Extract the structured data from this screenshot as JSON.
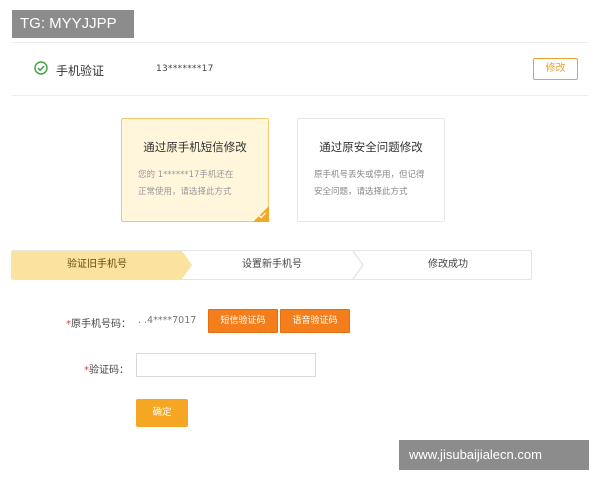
{
  "watermarks": {
    "tg": "TG: MYYJJPP",
    "url": "www.jisubaijialecn.com"
  },
  "verify_row": {
    "label": "手机验证",
    "phone": "13*******17",
    "edit_label": "修改",
    "icon": "check-circle-icon"
  },
  "options": [
    {
      "title": "通过原手机短信修改",
      "desc_line1": "您的 1******17手机还在",
      "desc_line2": "正常使用，请选择此方式",
      "selected": true
    },
    {
      "title": "通过原安全问题修改",
      "desc_line1": "原手机号丢失或停用，但记得",
      "desc_line2": "安全问题，请选择此方式",
      "selected": false
    }
  ],
  "steps": [
    "验证旧手机号",
    "设置新手机号",
    "修改成功"
  ],
  "form": {
    "old_phone_required": "*",
    "old_phone_label": "原手机号码：",
    "old_phone_value": ". .4****7017",
    "sms_button": "短信验证码",
    "voice_button": "语音验证码",
    "code_required": "*",
    "code_label": "验证码：",
    "code_value": "",
    "confirm_button": "确定"
  },
  "colors": {
    "accent": "#f5a623",
    "button_orange": "#f57e1c",
    "selected_bg": "#fff6dc",
    "step_active": "#fbe29f",
    "success_green": "#3aa33a",
    "required_red": "#e23b3b"
  }
}
